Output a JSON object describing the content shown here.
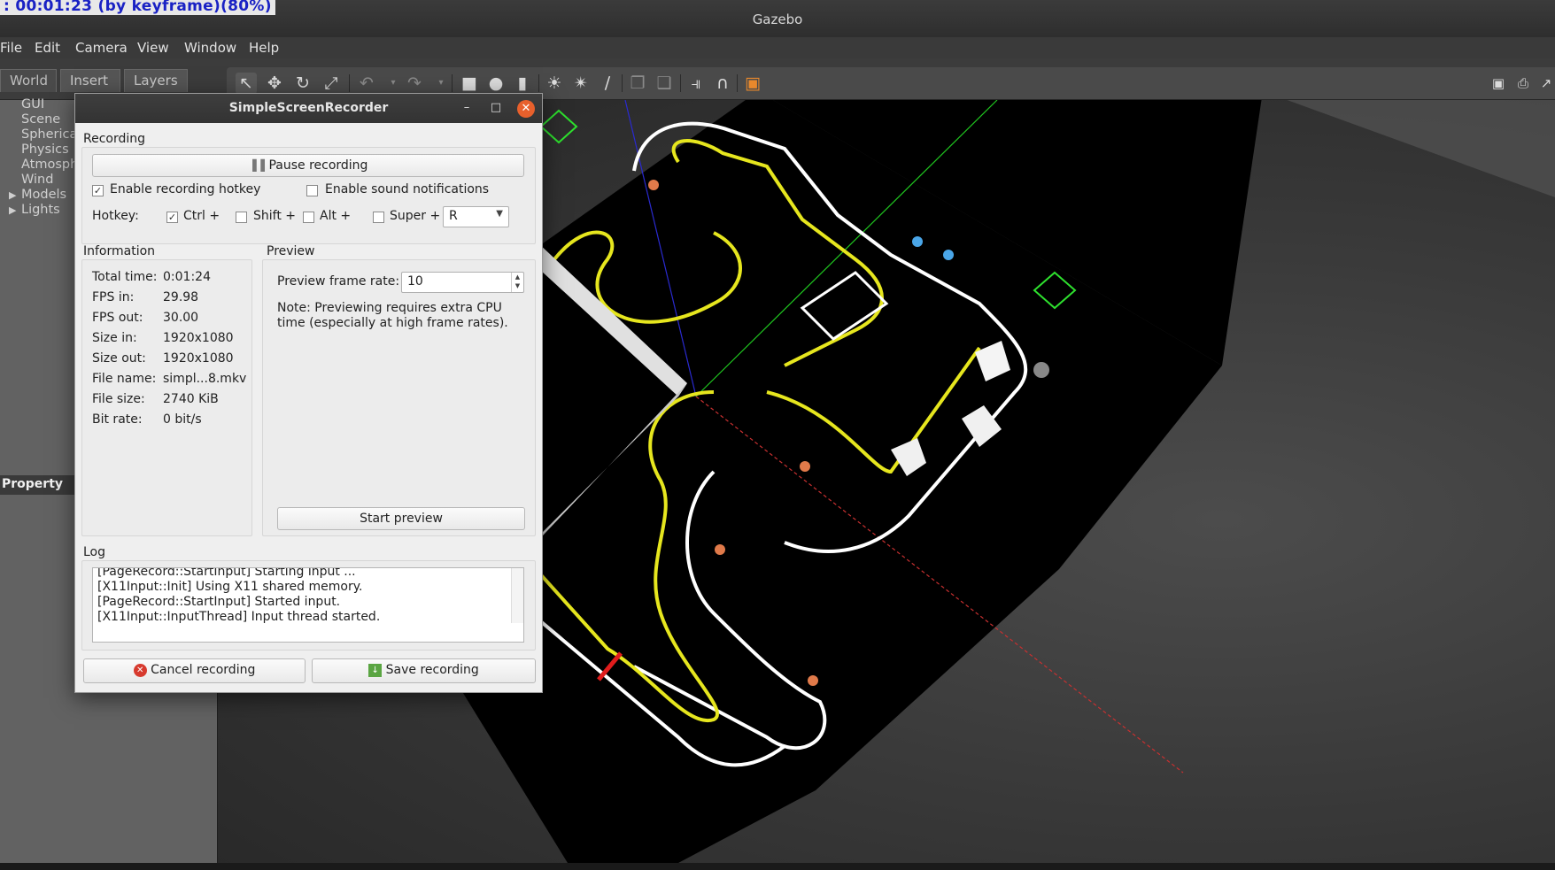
{
  "recording_overlay": ": 00:01:23 (by keyframe)(80%)",
  "gazebo": {
    "window_title": "Gazebo",
    "menu": [
      "File",
      "Edit",
      "Camera",
      "View",
      "Window",
      "Help"
    ],
    "left_tabs": [
      "World",
      "Insert",
      "Layers"
    ],
    "tree": [
      {
        "label": "GUI",
        "expandable": false
      },
      {
        "label": "Scene",
        "expandable": false
      },
      {
        "label": "Spherica",
        "expandable": false
      },
      {
        "label": "Physics",
        "expandable": false
      },
      {
        "label": "Atmosph",
        "expandable": false
      },
      {
        "label": "Wind",
        "expandable": false
      },
      {
        "label": "Models",
        "expandable": true
      },
      {
        "label": "Lights",
        "expandable": true
      }
    ],
    "property_header": "Property",
    "toolbar_icons": [
      "select-arrow-icon",
      "translate-icon",
      "rotate-icon",
      "scale-icon",
      "undo-icon",
      "redo-icon",
      "box-icon",
      "sphere-icon",
      "cylinder-icon",
      "point-light-icon",
      "spot-light-icon",
      "directional-light-icon",
      "copy-icon",
      "paste-icon",
      "align-icon",
      "snap-icon",
      "view-angle-icon",
      "screenshot-icon",
      "log-icon",
      "plot-icon"
    ]
  },
  "recorder": {
    "title": "SimpleScreenRecorder",
    "recording_label": "Recording",
    "pause_button": "Pause recording",
    "enable_hotkey_label": "Enable recording hotkey",
    "enable_hotkey_checked": true,
    "enable_sound_label": "Enable sound notifications",
    "enable_sound_checked": false,
    "hotkey_label": "Hotkey:",
    "hotkey_mods": [
      {
        "label": "Ctrl +",
        "checked": true
      },
      {
        "label": "Shift +",
        "checked": false
      },
      {
        "label": "Alt +",
        "checked": false
      },
      {
        "label": "Super +",
        "checked": false
      }
    ],
    "hotkey_key": "R",
    "information_label": "Information",
    "info": [
      {
        "k": "Total time:",
        "v": "0:01:24"
      },
      {
        "k": "FPS in:",
        "v": "29.98"
      },
      {
        "k": "FPS out:",
        "v": "30.00"
      },
      {
        "k": "Size in:",
        "v": "1920x1080"
      },
      {
        "k": "Size out:",
        "v": "1920x1080"
      },
      {
        "k": "File name:",
        "v": "simpl...8.mkv"
      },
      {
        "k": "File size:",
        "v": "2740 KiB"
      },
      {
        "k": "Bit rate:",
        "v": "0 bit/s"
      }
    ],
    "preview_label": "Preview",
    "preview_rate_label": "Preview frame rate:",
    "preview_rate_value": "10",
    "preview_note": "Note: Previewing requires extra CPU time (especially at high frame rates).",
    "start_preview": "Start preview",
    "log_label": "Log",
    "log": [
      "[PageRecord::StartInput] Starting input ...",
      "[X11Input::Init] Using X11 shared memory.",
      "[PageRecord::StartInput] Started input.",
      "[X11Input::InputThread] Input thread started."
    ],
    "cancel_button": "Cancel recording",
    "save_button": "Save recording"
  }
}
